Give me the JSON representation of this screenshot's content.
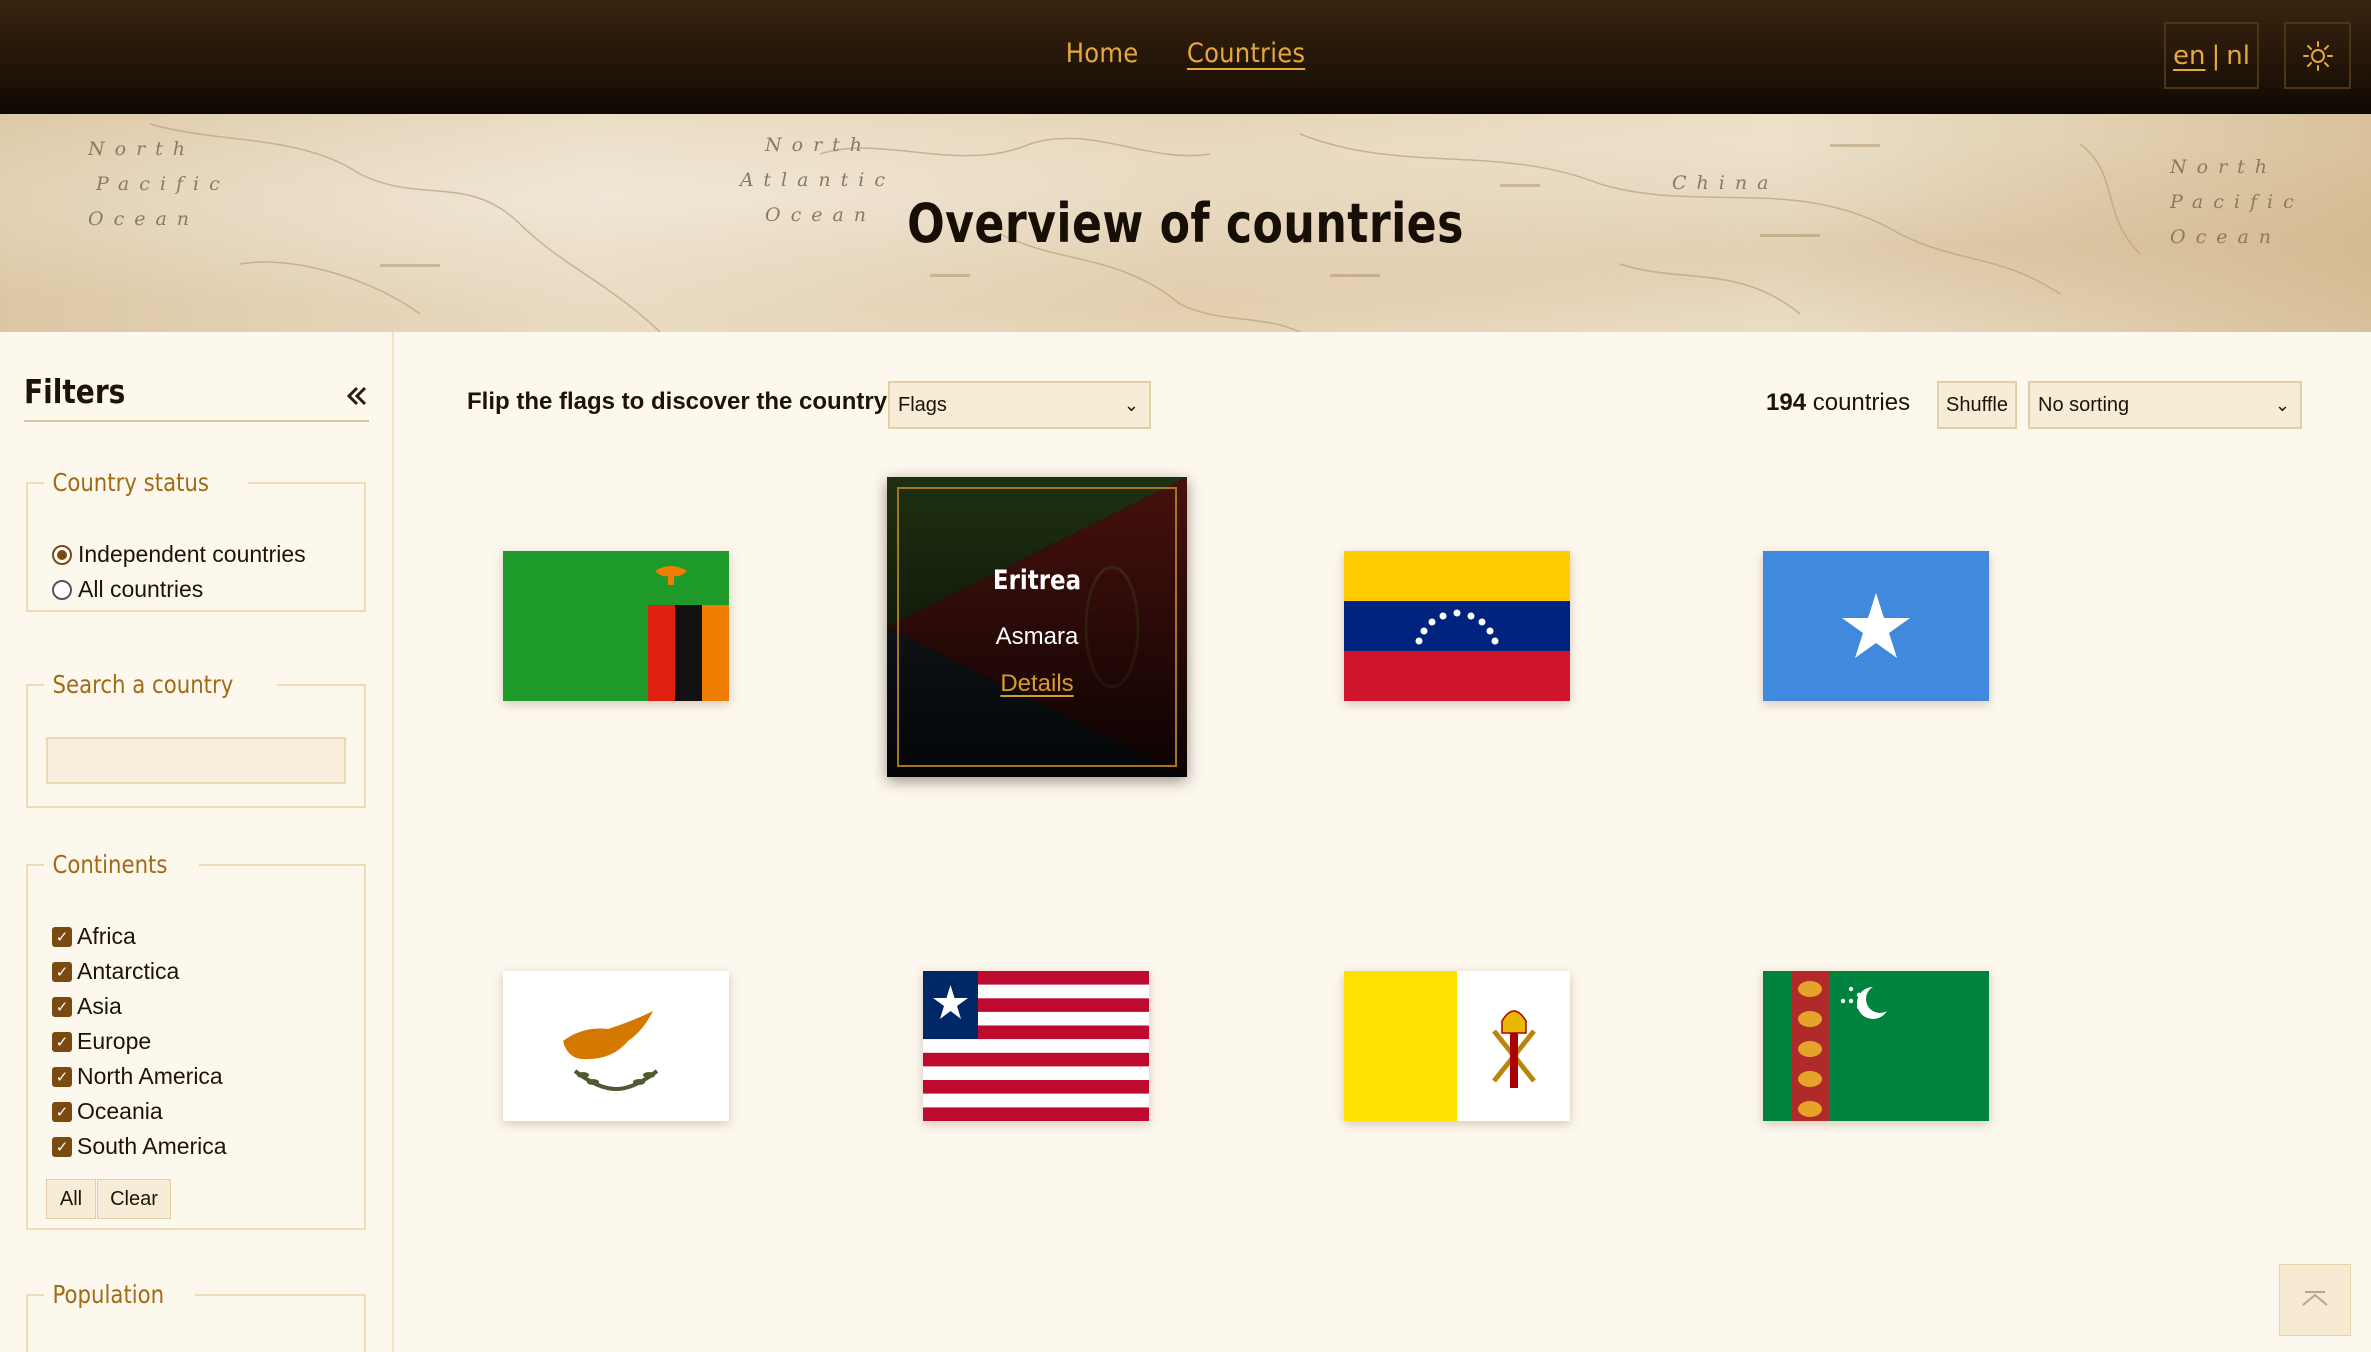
{
  "nav": {
    "home": "Home",
    "countries": "Countries",
    "lang_en": "en",
    "lang_sep": "|",
    "lang_nl": "nl",
    "theme_icon": "sun-icon"
  },
  "hero": {
    "title": "Overview of countries",
    "map_labels": {
      "north_pacific_left": [
        "North",
        "Pacific",
        "Ocean"
      ],
      "north_atlantic": [
        "North",
        "Atlantic",
        "Ocean"
      ],
      "china": "China",
      "north_pacific_right": [
        "North",
        "Pacific",
        "Ocean"
      ]
    }
  },
  "sidebar": {
    "title": "Filters",
    "collapse_icon": "double-chevron-left-icon",
    "status": {
      "legend": "Country status",
      "options": [
        {
          "label": "Independent countries",
          "selected": true
        },
        {
          "label": "All countries",
          "selected": false
        }
      ]
    },
    "search": {
      "legend": "Search a country",
      "value": "",
      "placeholder": ""
    },
    "continents": {
      "legend": "Continents",
      "items": [
        {
          "label": "Africa",
          "checked": true
        },
        {
          "label": "Antarctica",
          "checked": true
        },
        {
          "label": "Asia",
          "checked": true
        },
        {
          "label": "Europe",
          "checked": true
        },
        {
          "label": "North America",
          "checked": true
        },
        {
          "label": "Oceania",
          "checked": true
        },
        {
          "label": "South America",
          "checked": true
        }
      ],
      "all_label": "All",
      "clear_label": "Clear"
    },
    "population": {
      "legend": "Population"
    }
  },
  "toolbar": {
    "flip_label": "Flip the flags to discover the country",
    "mode_value": "Flags",
    "count_number": "194",
    "count_suffix": " countries",
    "shuffle_label": "Shuffle",
    "sort_value": "No sorting"
  },
  "cards": [
    {
      "flag": "zambia"
    },
    {
      "flag": "eritrea",
      "flipped": true,
      "name": "Eritrea",
      "capital": "Asmara",
      "link": "Details"
    },
    {
      "flag": "venezuela"
    },
    {
      "flag": "somalia"
    },
    {
      "flag": "cyprus"
    },
    {
      "flag": "liberia"
    },
    {
      "flag": "vatican"
    },
    {
      "flag": "turkmenistan"
    }
  ],
  "scroll_top_icon": "chevron-up-icon",
  "colors": {
    "accent": "#e6a73b",
    "legend": "#a06b14",
    "checkbox": "#7a4a10",
    "page_bg": "#fdf8ee"
  }
}
